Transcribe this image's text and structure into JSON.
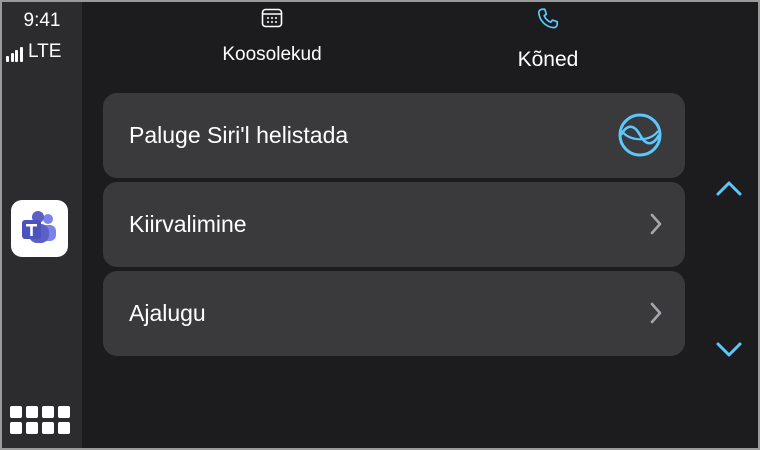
{
  "status": {
    "time": "9:41",
    "network": "LTE"
  },
  "rail": {
    "app_icon": "microsoft-teams-icon",
    "home_icon": "app-grid-icon"
  },
  "tabs": [
    {
      "label": "Koosolekud",
      "icon": "calendar-icon",
      "active": false
    },
    {
      "label": "Kõned",
      "icon": "phone-icon",
      "active": true
    }
  ],
  "list": [
    {
      "label": "Paluge Siri'l helistada",
      "icon": "siri-icon"
    },
    {
      "label": "Kiirvalimine",
      "icon": "chevron-right-icon"
    },
    {
      "label": "Ajalugu",
      "icon": "chevron-right-icon"
    }
  ],
  "scroll": {
    "up_icon": "chevron-up-icon",
    "down_icon": "chevron-down-icon"
  },
  "colors": {
    "background": "#1c1c1e",
    "rail": "#2c2c2e",
    "card": "#3a3a3c",
    "accent": "#5ac8fa",
    "teams": "#5b5fc7"
  }
}
